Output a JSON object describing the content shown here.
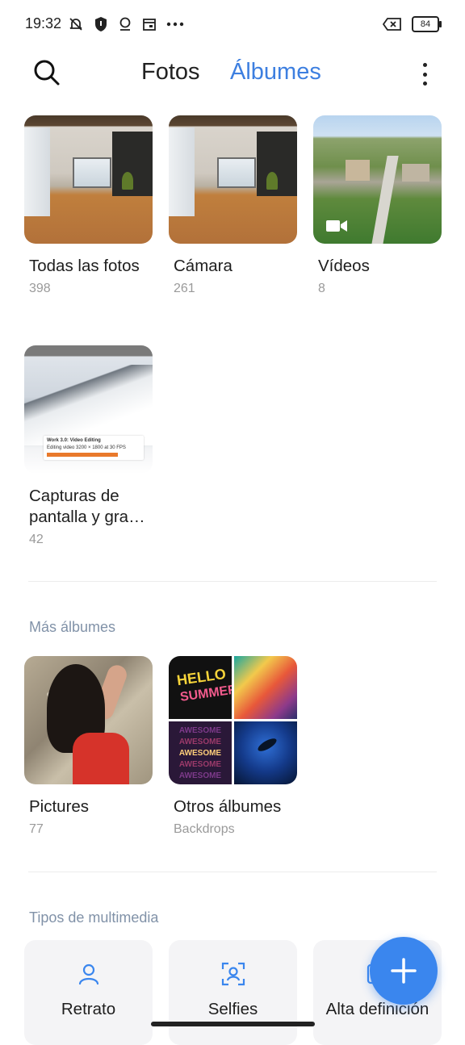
{
  "status_bar": {
    "time": "19:32",
    "battery": "84",
    "icons": [
      "notifications-muted-icon",
      "shield-icon",
      "location-icon",
      "calendar-icon",
      "more-notifications-icon",
      "battery-saver-icon",
      "battery-icon"
    ]
  },
  "header": {
    "tabs": [
      {
        "label": "Fotos",
        "active": false
      },
      {
        "label": "Álbumes",
        "active": true
      }
    ],
    "accent_color": "#3d7fe0"
  },
  "albums": [
    {
      "name": "Todas las fotos",
      "count": "398"
    },
    {
      "name": "Cámara",
      "count": "261"
    },
    {
      "name": "Vídeos",
      "count": "8"
    },
    {
      "name": "Capturas de pantalla y gra…",
      "count": "42"
    }
  ],
  "screenshot_thumb": {
    "title": "Work 3.0: Video Editing",
    "subtitle": "Editing video 3200 × 1800 at 30 FPS"
  },
  "more_albums": {
    "title": "Más álbumes",
    "items": [
      {
        "name": "Pictures",
        "count": "77"
      },
      {
        "name": "Otros álbumes",
        "count": "Backdrops"
      }
    ]
  },
  "mosaic_text": {
    "hello": "HELLO",
    "summer": "SUMMER",
    "awesome": "AWESOME"
  },
  "media_types": {
    "title": "Tipos de multimedia",
    "items": [
      {
        "label": "Retrato"
      },
      {
        "label": "Selfies"
      },
      {
        "label": "Alta definición"
      }
    ]
  },
  "fab": {
    "icon": "plus-icon",
    "color": "#3a86ee"
  }
}
